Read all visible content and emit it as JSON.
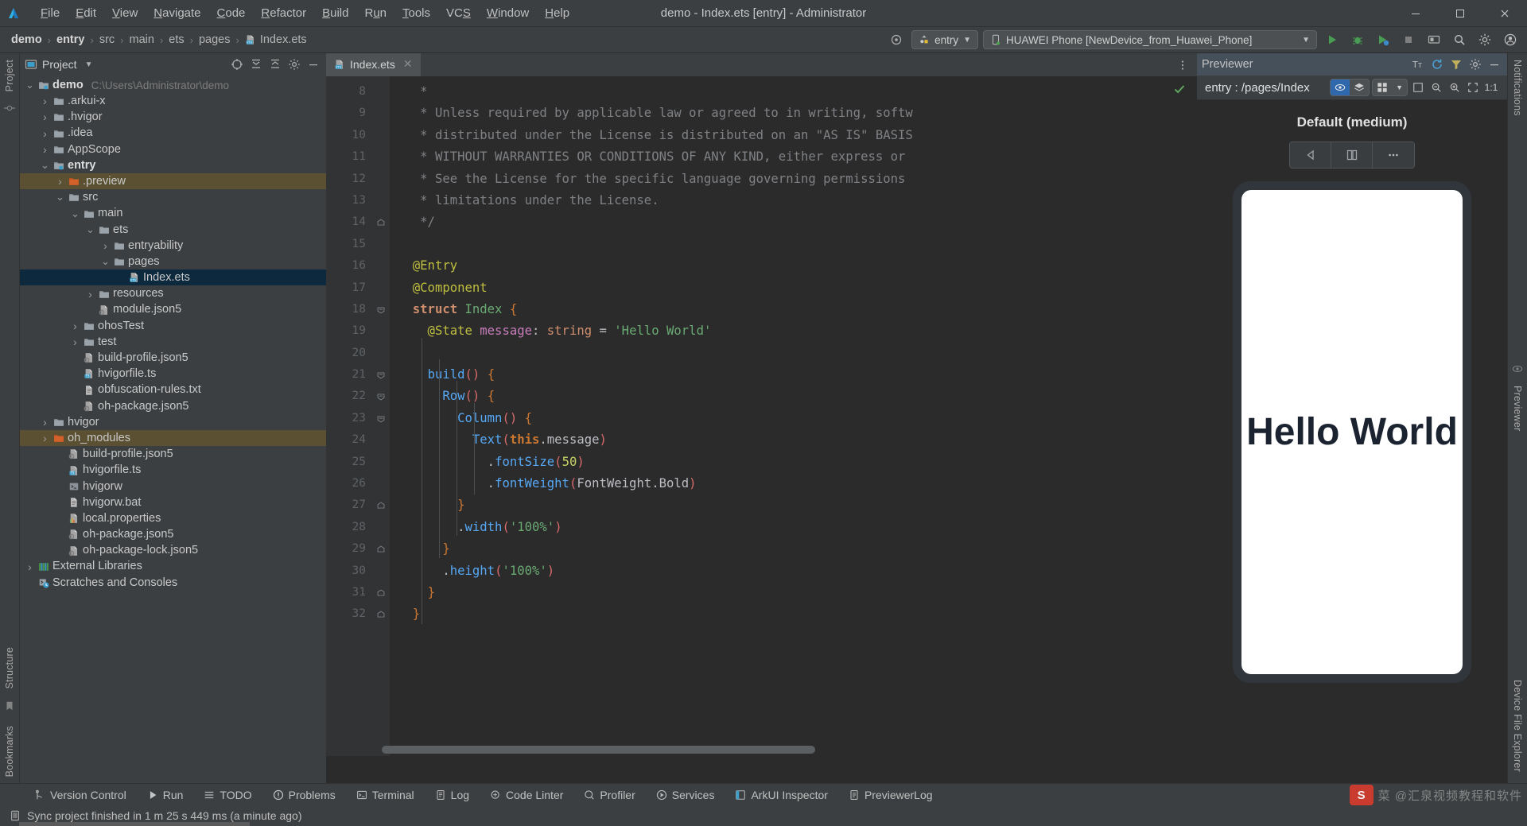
{
  "window": {
    "title": "demo - Index.ets [entry] - Administrator",
    "minimize_label": "Minimize",
    "maximize_label": "Maximize",
    "close_label": "Close"
  },
  "menubar": {
    "items": [
      {
        "label": "File",
        "mnemonic": "F"
      },
      {
        "label": "Edit",
        "mnemonic": "E"
      },
      {
        "label": "View",
        "mnemonic": "V"
      },
      {
        "label": "Navigate",
        "mnemonic": "N"
      },
      {
        "label": "Code",
        "mnemonic": "C"
      },
      {
        "label": "Refactor",
        "mnemonic": "R"
      },
      {
        "label": "Build",
        "mnemonic": "B"
      },
      {
        "label": "Run",
        "mnemonic": "u"
      },
      {
        "label": "Tools",
        "mnemonic": "T"
      },
      {
        "label": "VCS",
        "mnemonic": "S"
      },
      {
        "label": "Window",
        "mnemonic": "W"
      },
      {
        "label": "Help",
        "mnemonic": "H"
      }
    ]
  },
  "breadcrumb": {
    "items": [
      "demo",
      "entry",
      "src",
      "main",
      "ets",
      "pages"
    ],
    "file": "Index.ets",
    "separator": "›"
  },
  "toolbar": {
    "target_icon": "target-icon",
    "run_config": "entry",
    "device": "HUAWEI Phone [NewDevice_from_Huawei_Phone]",
    "run_label": "Run",
    "debug_label": "Debug",
    "profile_label": "Profile",
    "stop_label": "Stop",
    "device_manager_label": "Device Manager",
    "search_label": "Search Everywhere",
    "settings_label": "Settings",
    "account_label": "Account"
  },
  "left_rail": {
    "project_tab": "Project",
    "structure_tab": "Structure",
    "bookmarks_tab": "Bookmarks"
  },
  "right_rail": {
    "notifications_tab": "Notifications",
    "previewer_tab": "Previewer",
    "device_file_explorer_tab": "Device File Explorer"
  },
  "project_panel": {
    "title": "Project",
    "dropdown_icon": "chevron-down-icon",
    "header_icons": [
      "select-opened-file-icon",
      "expand-all-icon",
      "collapse-all-icon",
      "settings-icon",
      "hide-icon"
    ],
    "tree": [
      {
        "label": "demo",
        "path": "C:\\Users\\Administrator\\demo",
        "depth": 0,
        "twisty": "open",
        "icon": "module-folder-icon",
        "bold": true
      },
      {
        "label": ".arkui-x",
        "depth": 1,
        "twisty": "closed",
        "icon": "folder-icon"
      },
      {
        "label": ".hvigor",
        "depth": 1,
        "twisty": "closed",
        "icon": "folder-icon"
      },
      {
        "label": ".idea",
        "depth": 1,
        "twisty": "closed",
        "icon": "folder-icon"
      },
      {
        "label": "AppScope",
        "depth": 1,
        "twisty": "closed",
        "icon": "folder-icon"
      },
      {
        "label": "entry",
        "depth": 1,
        "twisty": "open",
        "icon": "module-folder-icon",
        "bold": true
      },
      {
        "label": ".preview",
        "depth": 2,
        "twisty": "closed",
        "icon": "folder-orange-icon",
        "state": "highlight"
      },
      {
        "label": "src",
        "depth": 2,
        "twisty": "open",
        "icon": "folder-icon"
      },
      {
        "label": "main",
        "depth": 3,
        "twisty": "open",
        "icon": "folder-icon"
      },
      {
        "label": "ets",
        "depth": 4,
        "twisty": "open",
        "icon": "folder-icon"
      },
      {
        "label": "entryability",
        "depth": 5,
        "twisty": "closed",
        "icon": "folder-icon"
      },
      {
        "label": "pages",
        "depth": 5,
        "twisty": "open",
        "icon": "folder-icon"
      },
      {
        "label": "Index.ets",
        "depth": 6,
        "twisty": "none",
        "icon": "ets-file-icon",
        "state": "selected"
      },
      {
        "label": "resources",
        "depth": 4,
        "twisty": "closed",
        "icon": "folder-icon"
      },
      {
        "label": "module.json5",
        "depth": 4,
        "twisty": "none",
        "icon": "json5-file-icon"
      },
      {
        "label": "ohosTest",
        "depth": 3,
        "twisty": "closed",
        "icon": "folder-icon"
      },
      {
        "label": "test",
        "depth": 3,
        "twisty": "closed",
        "icon": "folder-icon"
      },
      {
        "label": "build-profile.json5",
        "depth": 3,
        "twisty": "none",
        "icon": "json5-file-icon"
      },
      {
        "label": "hvigorfile.ts",
        "depth": 3,
        "twisty": "none",
        "icon": "ts-file-icon"
      },
      {
        "label": "obfuscation-rules.txt",
        "depth": 3,
        "twisty": "none",
        "icon": "text-file-icon"
      },
      {
        "label": "oh-package.json5",
        "depth": 3,
        "twisty": "none",
        "icon": "json5-file-icon"
      },
      {
        "label": "hvigor",
        "depth": 1,
        "twisty": "closed",
        "icon": "folder-icon"
      },
      {
        "label": "oh_modules",
        "depth": 1,
        "twisty": "closed",
        "icon": "folder-orange-icon",
        "state": "highlight"
      },
      {
        "label": "build-profile.json5",
        "depth": 2,
        "twisty": "none",
        "icon": "json5-file-icon"
      },
      {
        "label": "hvigorfile.ts",
        "depth": 2,
        "twisty": "none",
        "icon": "ts-file-icon"
      },
      {
        "label": "hvigorw",
        "depth": 2,
        "twisty": "none",
        "icon": "shell-file-icon"
      },
      {
        "label": "hvigorw.bat",
        "depth": 2,
        "twisty": "none",
        "icon": "text-file-icon"
      },
      {
        "label": "local.properties",
        "depth": 2,
        "twisty": "none",
        "icon": "properties-file-icon"
      },
      {
        "label": "oh-package.json5",
        "depth": 2,
        "twisty": "none",
        "icon": "json5-file-icon"
      },
      {
        "label": "oh-package-lock.json5",
        "depth": 2,
        "twisty": "none",
        "icon": "json5-file-icon"
      },
      {
        "label": "External Libraries",
        "depth": 0,
        "twisty": "closed",
        "icon": "libraries-icon"
      },
      {
        "label": "Scratches and Consoles",
        "depth": 0,
        "twisty": "none",
        "icon": "scratches-icon"
      }
    ]
  },
  "editor": {
    "tab": {
      "label": "Index.ets",
      "icon": "ets-file-icon",
      "close_icon": "close-icon"
    },
    "more_icon": "more-vertical-icon",
    "inspection_status": "ok-check-icon",
    "first_line_number": 8,
    "lines": [
      {
        "n": 8,
        "fold": "",
        "tokens": [
          {
            "t": "   *",
            "c": "cm"
          }
        ]
      },
      {
        "n": 9,
        "fold": "",
        "tokens": [
          {
            "t": "   * Unless required by applicable law or agreed to in writing, softw",
            "c": "cm"
          }
        ]
      },
      {
        "n": 10,
        "fold": "",
        "tokens": [
          {
            "t": "   * distributed under the License is distributed on an \"AS IS\" BASIS",
            "c": "cm"
          }
        ]
      },
      {
        "n": 11,
        "fold": "",
        "tokens": [
          {
            "t": "   * WITHOUT WARRANTIES OR CONDITIONS OF ANY KIND, either express or ",
            "c": "cm"
          }
        ]
      },
      {
        "n": 12,
        "fold": "",
        "tokens": [
          {
            "t": "   * See the License for the specific language governing permissions ",
            "c": "cm"
          }
        ]
      },
      {
        "n": 13,
        "fold": "",
        "tokens": [
          {
            "t": "   * limitations under the License.",
            "c": "cm"
          }
        ]
      },
      {
        "n": 14,
        "fold": "end",
        "tokens": [
          {
            "t": "   */",
            "c": "cm"
          }
        ]
      },
      {
        "n": 15,
        "fold": "",
        "tokens": []
      },
      {
        "n": 16,
        "fold": "",
        "tokens": [
          {
            "t": "  @Entry",
            "c": "ann"
          }
        ]
      },
      {
        "n": 17,
        "fold": "",
        "tokens": [
          {
            "t": "  @Component",
            "c": "ann"
          }
        ]
      },
      {
        "n": 18,
        "fold": "start",
        "tokens": [
          {
            "t": "  struct",
            "c": "kw"
          },
          {
            "t": " ",
            "c": "pln"
          },
          {
            "t": "Index",
            "c": "typ"
          },
          {
            "t": " ",
            "c": "pln"
          },
          {
            "t": "{",
            "c": "brc"
          }
        ]
      },
      {
        "n": 19,
        "fold": "",
        "tokens": [
          {
            "t": "    @State",
            "c": "ann"
          },
          {
            "t": " ",
            "c": "pln"
          },
          {
            "t": "message",
            "c": "prop"
          },
          {
            "t": ": ",
            "c": "pln"
          },
          {
            "t": "string",
            "c": "ptype"
          },
          {
            "t": " = ",
            "c": "pln"
          },
          {
            "t": "'Hello World'",
            "c": "str"
          }
        ]
      },
      {
        "n": 20,
        "fold": "",
        "tokens": []
      },
      {
        "n": 21,
        "fold": "start",
        "tokens": [
          {
            "t": "    ",
            "c": "pln"
          },
          {
            "t": "build",
            "c": "fn"
          },
          {
            "t": "()",
            "c": "par"
          },
          {
            "t": " ",
            "c": "pln"
          },
          {
            "t": "{",
            "c": "brc"
          }
        ]
      },
      {
        "n": 22,
        "fold": "start",
        "tokens": [
          {
            "t": "      ",
            "c": "pln"
          },
          {
            "t": "Row",
            "c": "fn"
          },
          {
            "t": "()",
            "c": "par"
          },
          {
            "t": " ",
            "c": "pln"
          },
          {
            "t": "{",
            "c": "brc"
          }
        ]
      },
      {
        "n": 23,
        "fold": "start",
        "tokens": [
          {
            "t": "        ",
            "c": "pln"
          },
          {
            "t": "Column",
            "c": "fn"
          },
          {
            "t": "()",
            "c": "par"
          },
          {
            "t": " ",
            "c": "pln"
          },
          {
            "t": "{",
            "c": "brc"
          }
        ]
      },
      {
        "n": 24,
        "fold": "",
        "tokens": [
          {
            "t": "          ",
            "c": "pln"
          },
          {
            "t": "Text",
            "c": "fn"
          },
          {
            "t": "(",
            "c": "par"
          },
          {
            "t": "this",
            "c": "ths"
          },
          {
            "t": ".message",
            "c": "pln"
          },
          {
            "t": ")",
            "c": "par"
          }
        ]
      },
      {
        "n": 25,
        "fold": "",
        "tokens": [
          {
            "t": "            .",
            "c": "pln"
          },
          {
            "t": "fontSize",
            "c": "fn"
          },
          {
            "t": "(",
            "c": "par"
          },
          {
            "t": "50",
            "c": "num"
          },
          {
            "t": ")",
            "c": "par"
          }
        ]
      },
      {
        "n": 26,
        "fold": "",
        "tokens": [
          {
            "t": "            .",
            "c": "pln"
          },
          {
            "t": "fontWeight",
            "c": "fn"
          },
          {
            "t": "(",
            "c": "par"
          },
          {
            "t": "FontWeight.Bold",
            "c": "pln"
          },
          {
            "t": ")",
            "c": "par"
          }
        ]
      },
      {
        "n": 27,
        "fold": "end",
        "tokens": [
          {
            "t": "        ",
            "c": "pln"
          },
          {
            "t": "}",
            "c": "brc"
          }
        ]
      },
      {
        "n": 28,
        "fold": "",
        "tokens": [
          {
            "t": "        .",
            "c": "pln"
          },
          {
            "t": "width",
            "c": "fn"
          },
          {
            "t": "(",
            "c": "par"
          },
          {
            "t": "'100%'",
            "c": "str"
          },
          {
            "t": ")",
            "c": "par"
          }
        ]
      },
      {
        "n": 29,
        "fold": "end",
        "tokens": [
          {
            "t": "      ",
            "c": "pln"
          },
          {
            "t": "}",
            "c": "brc"
          }
        ]
      },
      {
        "n": 30,
        "fold": "",
        "tokens": [
          {
            "t": "      .",
            "c": "pln"
          },
          {
            "t": "height",
            "c": "fn"
          },
          {
            "t": "(",
            "c": "par"
          },
          {
            "t": "'100%'",
            "c": "str"
          },
          {
            "t": ")",
            "c": "par"
          }
        ]
      },
      {
        "n": 31,
        "fold": "end",
        "tokens": [
          {
            "t": "    ",
            "c": "pln"
          },
          {
            "t": "}",
            "c": "brc"
          }
        ]
      },
      {
        "n": 32,
        "fold": "end",
        "tokens": [
          {
            "t": "  ",
            "c": "pln"
          },
          {
            "t": "}",
            "c": "brc"
          }
        ]
      }
    ]
  },
  "previewer": {
    "title": "Previewer",
    "header_icons": [
      "font-size-icon",
      "refresh-icon",
      "filter-icon",
      "settings-icon",
      "minimize-icon"
    ],
    "route": "entry : /pages/Index",
    "sub_icons": [
      "inspect-icon",
      "layers-icon",
      "multi-device-icon",
      "chevron-down-icon",
      "fit-icon",
      "zoom-out-icon",
      "zoom-in-icon",
      "fullscreen-icon",
      "actual-size-icon"
    ],
    "zoom_label": "1:1",
    "device_name": "Default (medium)",
    "controls": [
      "rotate-left-icon",
      "fold-icon",
      "more-icon"
    ],
    "preview_text": "Hello World"
  },
  "bottom_bar": {
    "items": [
      {
        "label": "Version Control",
        "icon": "branch-icon"
      },
      {
        "label": "Run",
        "icon": "play-icon"
      },
      {
        "label": "TODO",
        "icon": "list-icon"
      },
      {
        "label": "Problems",
        "icon": "warning-icon"
      },
      {
        "label": "Terminal",
        "icon": "terminal-icon"
      },
      {
        "label": "Log",
        "icon": "log-icon"
      },
      {
        "label": "Code Linter",
        "icon": "linter-icon"
      },
      {
        "label": "Profiler",
        "icon": "profiler-icon"
      },
      {
        "label": "Services",
        "icon": "services-icon"
      },
      {
        "label": "ArkUI Inspector",
        "icon": "inspector-icon"
      },
      {
        "label": "PreviewerLog",
        "icon": "previewerlog-icon"
      }
    ]
  },
  "status_bar": {
    "icon": "memory-icon",
    "message": "Sync project finished in 1 m 25 s 449 ms (a minute ago)"
  },
  "watermark": {
    "logo_text": "S",
    "text": "菜 @汇泉视频教程和软件"
  },
  "colors": {
    "accent_blue": "#2f68ad",
    "selection_blue": "#0d293e",
    "highlight_olive": "#5b5132",
    "panel_bg": "#3c3f41",
    "editor_bg": "#2b2b2b",
    "gutter_bg": "#313335",
    "previewer_header": "#46505a",
    "folder_orange": "#d4612a",
    "run_green": "#499c54"
  }
}
